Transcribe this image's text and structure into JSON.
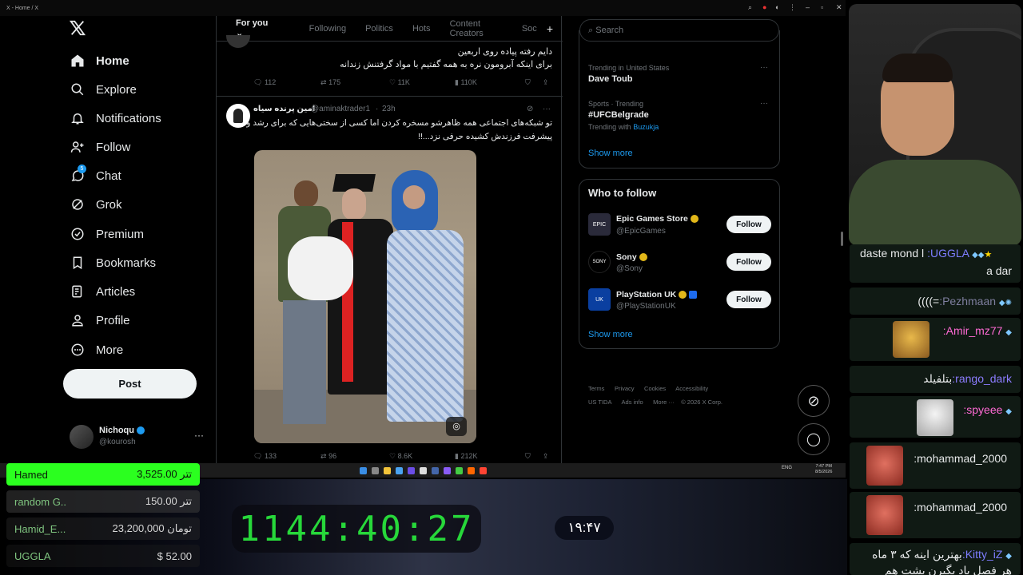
{
  "window": {
    "title": "X - Home / X"
  },
  "nav": {
    "items": [
      {
        "label": "Home",
        "icon": "home-icon"
      },
      {
        "label": "Explore",
        "icon": "search-icon"
      },
      {
        "label": "Notifications",
        "icon": "bell-icon"
      },
      {
        "label": "Follow",
        "icon": "add-user-icon"
      },
      {
        "label": "Chat",
        "icon": "chat-icon",
        "badge": "5"
      },
      {
        "label": "Grok",
        "icon": "grok-icon"
      },
      {
        "label": "Premium",
        "icon": "premium-icon"
      },
      {
        "label": "Bookmarks",
        "icon": "bookmark-icon"
      },
      {
        "label": "Articles",
        "icon": "articles-icon"
      },
      {
        "label": "Profile",
        "icon": "profile-icon"
      },
      {
        "label": "More",
        "icon": "more-icon"
      }
    ],
    "post_label": "Post",
    "account": {
      "name": "Nichoqu",
      "handle": "@kourosh"
    }
  },
  "feed": {
    "tabs": [
      "For you",
      "Following",
      "Politics",
      "Hots",
      "Content Creators",
      "Soc"
    ],
    "tweet1": {
      "line1": "دایم رفته پیاده روی اربعین",
      "line2": "برای اینکه آبرومون نره به همه گفتیم با مواد گرفتنش زندانه",
      "replies": "112",
      "reposts": "175",
      "likes": "11K",
      "views": "110K"
    },
    "tweet2": {
      "name": "امین پرنده سیاه",
      "handle": "@aminaktrader1",
      "time": "23h",
      "line1": "تو شبکه‌های اجتماعی همه ظاهرشو مسخره کردن اما کسی از سختی‌هایی که برای رشد و",
      "line2": "پیشرفت فرزندش کشیده حرفی نزد...!!",
      "replies": "133",
      "reposts": "96",
      "likes": "8.6K",
      "views": "212K"
    }
  },
  "search": {
    "placeholder": "Search"
  },
  "trends": {
    "items": [
      {
        "context": "Trending in United States",
        "name": "Dave Toub"
      },
      {
        "context": "Sports · Trending",
        "name": "#UFCBelgrade",
        "with_label": "Trending with",
        "with": "Buzukja"
      }
    ],
    "show_more": "Show more"
  },
  "who_to_follow": {
    "title": "Who to follow",
    "accounts": [
      {
        "name": "Epic Games Store",
        "handle": "@EpicGames"
      },
      {
        "name": "Sony",
        "handle": "@Sony"
      },
      {
        "name": "PlayStation UK",
        "handle": "@PlayStationUK"
      }
    ],
    "follow_label": "Follow",
    "show_more": "Show more"
  },
  "footer": {
    "links": [
      "Terms",
      "Privacy",
      "Cookies",
      "Accessibility",
      "US TIDA",
      "Ads info",
      "More ···",
      "© 2026 X Corp."
    ]
  },
  "taskbar": {
    "lang": "ENG",
    "time": "7:47 PM",
    "date": "8/5/2026"
  },
  "donations": [
    {
      "name": "Hamed",
      "amount": "3,525.00 تتر"
    },
    {
      "name": "random G..",
      "amount": "150.00 تتر"
    },
    {
      "name": "Hamid_E...",
      "amount": "23,200,000 تومان"
    },
    {
      "name": "UGGLA",
      "amount": "$ 52.00"
    }
  ],
  "timer": "1144:40:27",
  "clock": "۱۹:۴۷",
  "chat": [
    {
      "user": ":UGGLA",
      "text": "daste mond l",
      "text2": "a dar"
    },
    {
      "user": ":Pezhmaan",
      "text": "((((="
    },
    {
      "user": ":Amir_mz77",
      "text": ""
    },
    {
      "user": ":rango_dark",
      "text": "بتلفیلد"
    },
    {
      "user": ":spyeee",
      "text": ""
    },
    {
      "user": ":mohammad_2000",
      "text": ""
    },
    {
      "user": ":mohammad_2000",
      "text": ""
    },
    {
      "user": ":Kitty_iZ",
      "text": "بهترین اینه که ۳ ماه",
      "text2": "هر فصل باد بگیرن بشت هم"
    }
  ],
  "colors": {
    "accent": "#1d9bf0",
    "donation_top": "#2bff1f",
    "timer": "#27d83a"
  }
}
